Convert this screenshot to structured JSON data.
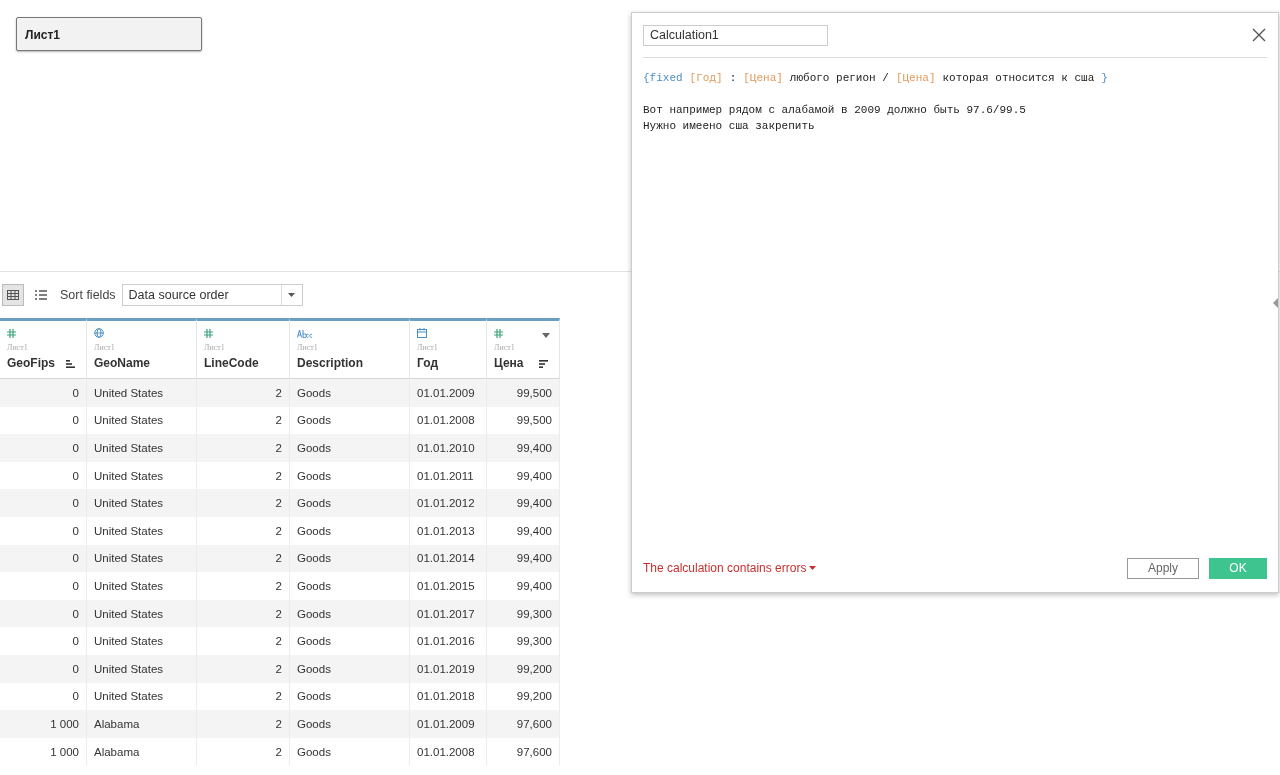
{
  "sheet_tab": {
    "label": "Лист1"
  },
  "toolbar": {
    "views": [
      {
        "kind": "grid",
        "selected": true
      },
      {
        "kind": "list",
        "selected": false
      }
    ],
    "sort_label": "Sort fields",
    "sort_value": "Data source order"
  },
  "table": {
    "columns": [
      {
        "kind": "number",
        "source": "Лист1",
        "name": "GeoFips",
        "sorted_ascending": true
      },
      {
        "kind": "geo",
        "source": "Лист1",
        "name": "GeoName"
      },
      {
        "kind": "number",
        "source": "Лист1",
        "name": "LineCode"
      },
      {
        "kind": "string",
        "source": "Лист1",
        "name": "Description"
      },
      {
        "kind": "date",
        "source": "Лист1",
        "name": "Год"
      },
      {
        "kind": "number",
        "source": "Лист1",
        "name": "Цена",
        "sorted_descending": true,
        "menu": true
      }
    ],
    "rows": [
      [
        "0",
        "United States",
        "2",
        "Goods",
        "01.01.2009",
        "99,500"
      ],
      [
        "0",
        "United States",
        "2",
        "Goods",
        "01.01.2008",
        "99,500"
      ],
      [
        "0",
        "United States",
        "2",
        "Goods",
        "01.01.2010",
        "99,400"
      ],
      [
        "0",
        "United States",
        "2",
        "Goods",
        "01.01.2011",
        "99,400"
      ],
      [
        "0",
        "United States",
        "2",
        "Goods",
        "01.01.2012",
        "99,400"
      ],
      [
        "0",
        "United States",
        "2",
        "Goods",
        "01.01.2013",
        "99,400"
      ],
      [
        "0",
        "United States",
        "2",
        "Goods",
        "01.01.2014",
        "99,400"
      ],
      [
        "0",
        "United States",
        "2",
        "Goods",
        "01.01.2015",
        "99,400"
      ],
      [
        "0",
        "United States",
        "2",
        "Goods",
        "01.01.2017",
        "99,300"
      ],
      [
        "0",
        "United States",
        "2",
        "Goods",
        "01.01.2016",
        "99,300"
      ],
      [
        "0",
        "United States",
        "2",
        "Goods",
        "01.01.2019",
        "99,200"
      ],
      [
        "0",
        "United States",
        "2",
        "Goods",
        "01.01.2018",
        "99,200"
      ],
      [
        "1 000",
        "Alabama",
        "2",
        "Goods",
        "01.01.2009",
        "97,600"
      ],
      [
        "1 000",
        "Alabama",
        "2",
        "Goods",
        "01.01.2008",
        "97,600"
      ]
    ]
  },
  "dialog": {
    "name": "Calculation1",
    "formula": [
      {
        "kind": "keyword",
        "text": "{fixed"
      },
      {
        "kind": "field",
        "text": "[Год]"
      },
      {
        "kind": "plain",
        "text": ":"
      },
      {
        "kind": "field",
        "text": "[Цена]"
      },
      {
        "kind": "plain",
        "text": "любого регион /"
      },
      {
        "kind": "field",
        "text": "[Цена]"
      },
      {
        "kind": "plain",
        "text": "которая относится к сша"
      },
      {
        "kind": "keyword",
        "text": "}"
      }
    ],
    "notes": [
      "Вот например рядом с алабамой в 2009 должно быть 97.6/99.5",
      "Нужно имеено сша закрепить"
    ],
    "error": "The calculation contains errors",
    "apply": "Apply",
    "ok": "OK"
  }
}
